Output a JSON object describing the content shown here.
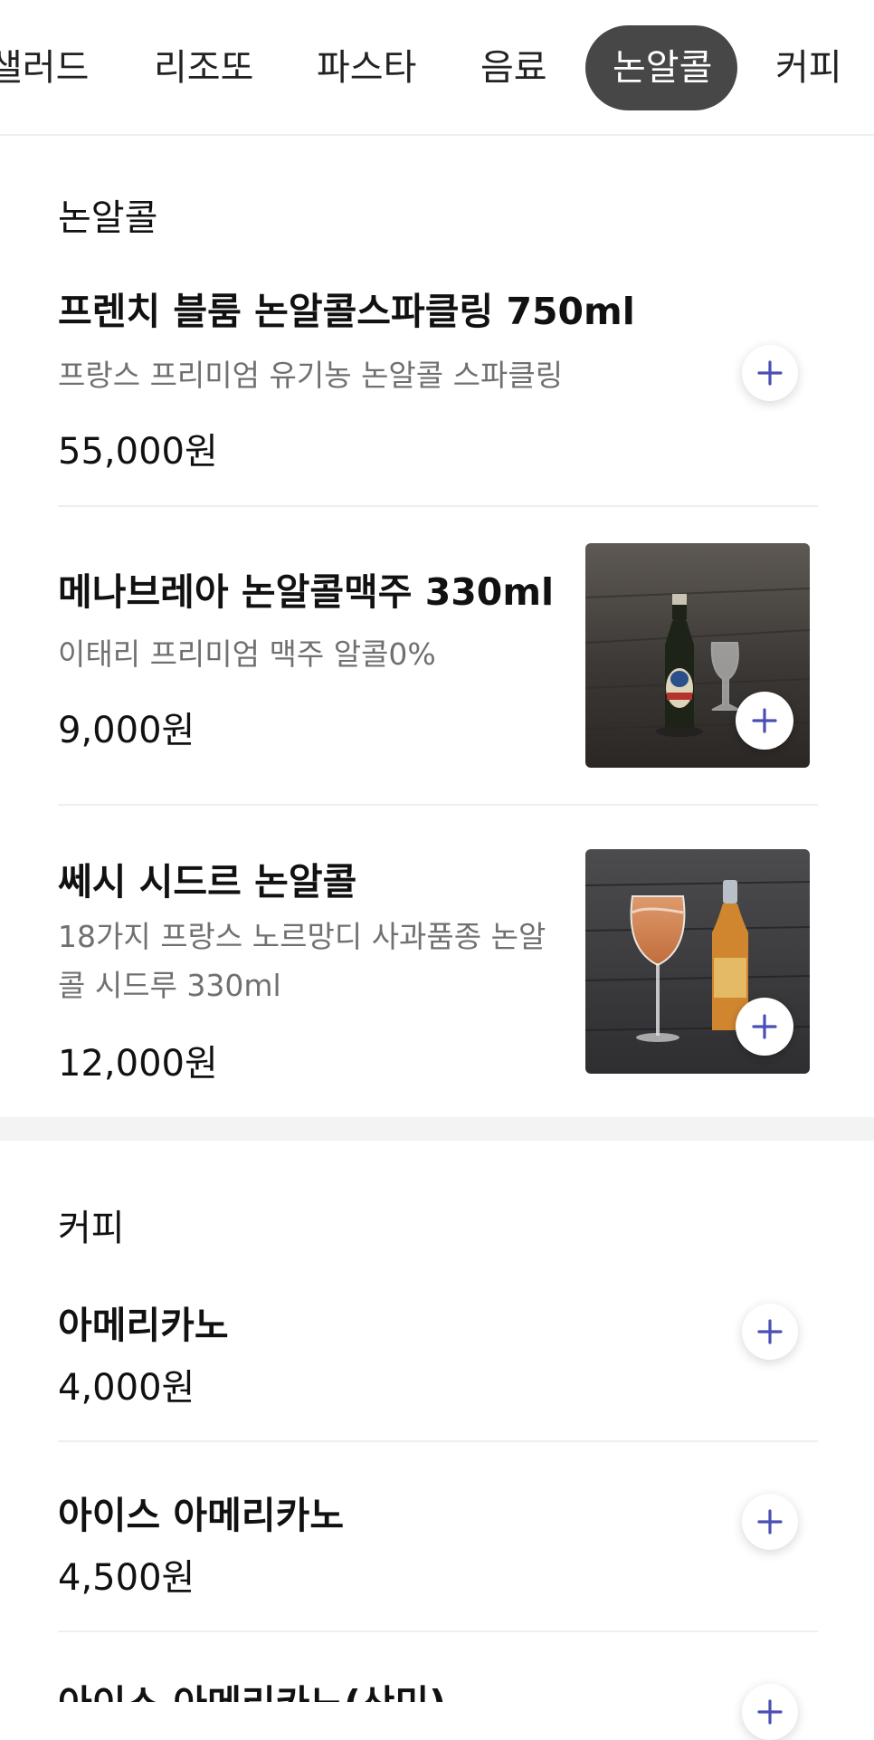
{
  "tabs": [
    {
      "label": "샐러드",
      "active": false
    },
    {
      "label": "리조또",
      "active": false
    },
    {
      "label": "파스타",
      "active": false
    },
    {
      "label": "음료",
      "active": false
    },
    {
      "label": "논알콜",
      "active": true
    },
    {
      "label": "커피",
      "active": false
    }
  ],
  "sections": [
    {
      "title": "논알콜",
      "items": [
        {
          "name": "프렌치 블룸 논알콜스파클링 750ml",
          "description": "프랑스 프리미엄 유기농 논알콜 스파클링",
          "price": "55,000원",
          "has_photo": false
        },
        {
          "name": "메나브레아 논알콜맥주 330ml",
          "description": "이태리 프리미엄 맥주 알콜0%",
          "price": "9,000원",
          "has_photo": true,
          "photo_icon": "beer-bottle-glass-photo"
        },
        {
          "name": "쎄시 시드르 논알콜",
          "description_lines": [
            "18가지 프랑스 노르망디 사과품종 논알",
            "콜 시드루 330ml"
          ],
          "price": "12,000원",
          "has_photo": true,
          "photo_icon": "cider-bottle-wineglass-photo"
        }
      ]
    },
    {
      "title": "커피",
      "items": [
        {
          "name": "아메리카노",
          "price": "4,000원",
          "has_photo": false
        },
        {
          "name": "아이스 아메리카노",
          "price": "4,500원",
          "has_photo": false
        },
        {
          "name": "아이스 아메리카노(산미)",
          "has_photo": false
        }
      ]
    }
  ],
  "icons": {
    "add": "plus-icon"
  },
  "colors": {
    "accent": "#4b4fb4",
    "active_tab_bg": "#474747",
    "description_text": "#707070",
    "divider": "#efefef",
    "band": "#f3f3f4"
  }
}
